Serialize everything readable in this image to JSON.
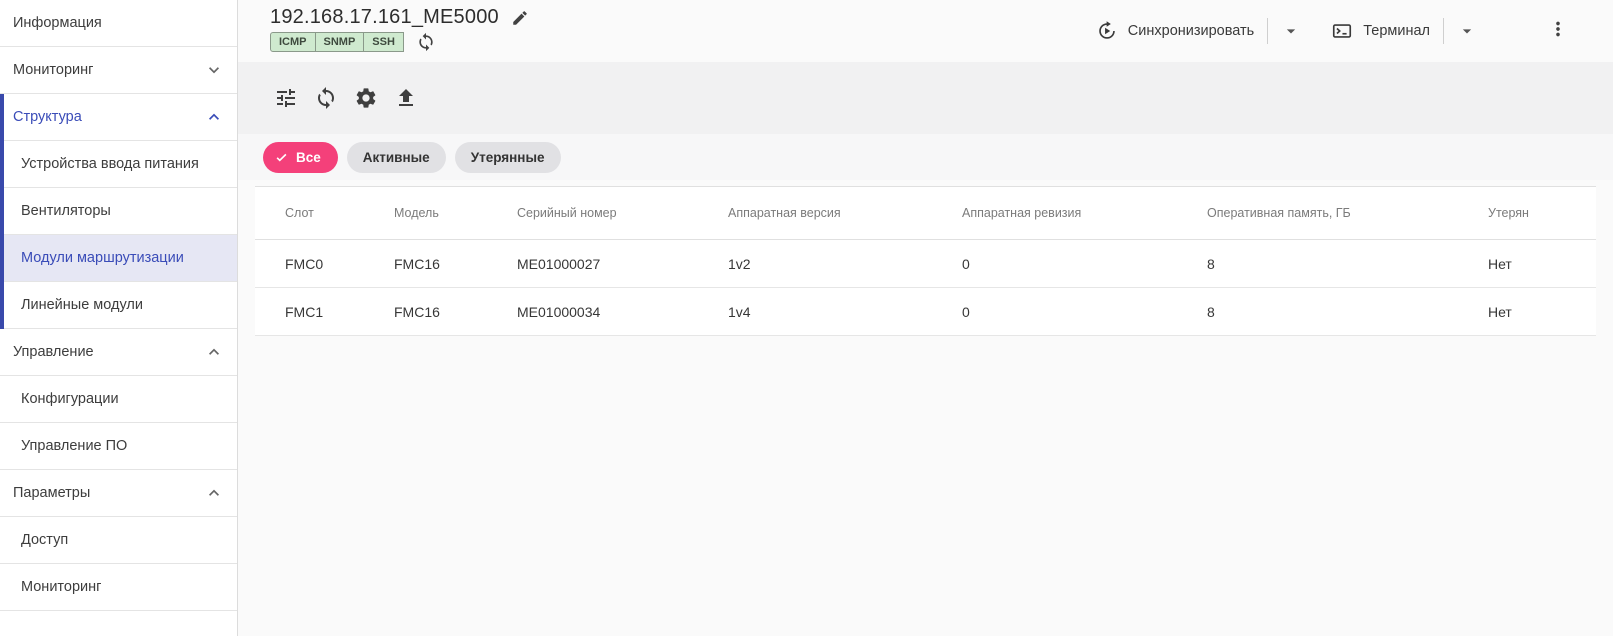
{
  "sidebar": {
    "items": [
      {
        "label": "Информация"
      },
      {
        "label": "Мониторинг"
      },
      {
        "label": "Структура"
      },
      {
        "label": "Устройства ввода питания"
      },
      {
        "label": "Вентиляторы"
      },
      {
        "label": "Модули маршрутизации"
      },
      {
        "label": "Линейные модули"
      },
      {
        "label": "Управление"
      },
      {
        "label": "Конфигурации"
      },
      {
        "label": "Управление ПО"
      },
      {
        "label": "Параметры"
      },
      {
        "label": "Доступ"
      },
      {
        "label": "Мониторинг"
      }
    ]
  },
  "header": {
    "title": "192.168.17.161_ME5000",
    "badges": [
      "ICMP",
      "SNMP",
      "SSH"
    ],
    "sync_button": "Синхронизировать",
    "terminal_button": "Терминал"
  },
  "toolbar": {
    "icons": [
      "tune-icon",
      "refresh-icon",
      "gear-icon",
      "upload-icon"
    ]
  },
  "filters": {
    "chips": [
      "Все",
      "Активные",
      "Утерянные"
    ],
    "selected": "Все"
  },
  "table": {
    "columns": [
      "Слот",
      "Модель",
      "Серийный номер",
      "Аппаратная версия",
      "Аппаратная ревизия",
      "Оперативная память, ГБ",
      "Утерян"
    ],
    "rows": [
      [
        "FMC0",
        "FMC16",
        "ME01000027",
        "1v2",
        "0",
        "8",
        "Нет"
      ],
      [
        "FMC1",
        "FMC16",
        "ME01000034",
        "1v4",
        "0",
        "8",
        "Нет"
      ]
    ]
  },
  "colors": {
    "accent_pink": "#f4407a",
    "accent_indigo": "#3949ab",
    "selected_item_bg": "#e6e7f4",
    "badge_green_bg": "#cfeacf",
    "badge_green_border": "#8a998a"
  }
}
